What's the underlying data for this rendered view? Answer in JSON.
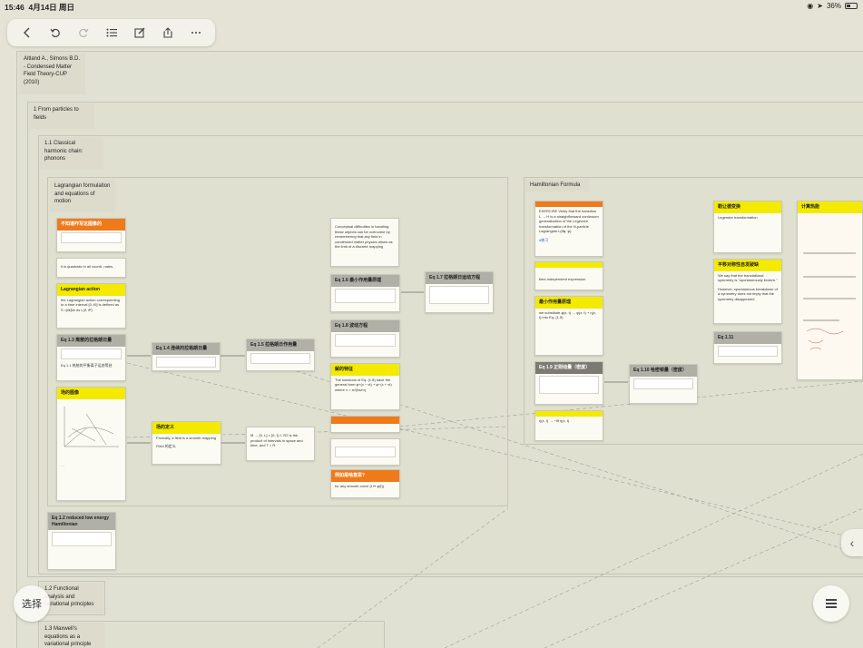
{
  "status": {
    "time": "15:46",
    "date": "4月14日 周日",
    "battery": "36%"
  },
  "toolbar": {
    "icons": [
      "chevron-left-icon",
      "undo-icon",
      "redo-icon",
      "list-icon",
      "edit-icon",
      "share-icon",
      "more-icon"
    ]
  },
  "frames": {
    "root": "Altland A., Simons B.D. - Condensed Matter Field Theory-CUP (2010)",
    "ch1": "1 From particles to fields",
    "s11": "1.1 Classical harmonic chain: phonons",
    "lagr": "Lagrangian formulation and equations of motion",
    "ham": "Hamiltonian Formula",
    "s12": "1.2 Functional analysis and variational principles",
    "s13": "1.3 Maxwell's equations as a variational principle"
  },
  "cards": {
    "c1": "不知道咋写这图像的",
    "c2": "it is quadratic in all coordi- nates.",
    "c3": "Lagrangian action",
    "c3b": "the Lagrangian action corresponding to a time interval [0, t0] is defined as S =∫dt∫dx ds L(∂, ∂²)",
    "c4": "Eq 1.3 离散的拉格朗日量",
    "c4b": "Eq 1.1 热统的平衡离子运态等处",
    "c5": "场的图像",
    "c6": "Eq 1.4 连续的拉格朗日量",
    "c7": "Eq 1.5 拉格朗日作用量",
    "c8": "场的定义",
    "c8b": "Formally, a field is a smooth mapping",
    "c8c": "Field 的定义",
    "c9": "M → [0, L] × [0, t] ⊂ R2 is the product of intervals in space and time, and T = R.",
    "c10": "Conceptual difficulties in handling these objects can be overcome by remembering that any field in condensed matter physics arises as the limit of a discrete mapping",
    "c11": "Eq 1.6 最小作用量原理",
    "c12": "Eq 1.7 拉格朗日运动方程",
    "c13": "Eq 1.8 波动方程",
    "c14": "解的特征",
    "c14b": "The solutions of Eq. (1.8) have the general form φ+(x − vt) + φ−(x + vt) where v = a√(ks/m)",
    "c15": "例如是啥意思?",
    "c15b": "for any smooth curve (t ↦ φ(t)).",
    "c16": "Eq 1.2 reduced low energy Hamiltonian",
    "h1": "EXERCISE Verify that the transition L → H is a straightforward continuum generalization of the Legendre transformation of the N-particle Lagrangian L(∂φ, φ).",
    "h1b": "#练习",
    "h2": "time-independent expression",
    "h3": "最小作用量原理",
    "h3b": "we substitute φ(x, t) → φ(x, t) + η(x, t) into Eq. (1.5)",
    "h4": "Eq 1.9 正则动量（密度）",
    "h5": "Eq 1.10 哈密顿量（密度）",
    "h6": "η(x, t) → −∂t η(x, t)",
    "h7": "勒让德变换",
    "h7b": "Legendre transformation",
    "h8": "平移对称性自发破缺",
    "h8b": "We say that the translational symmetry is \"spontaneously broken.\"",
    "h8c": "However, spontaneous breakdown of a symmetry does not imply that the symmetry disappeared",
    "h9": "Eq 1.11",
    "h10": "计算热能"
  },
  "buttons": {
    "select": "选择"
  }
}
